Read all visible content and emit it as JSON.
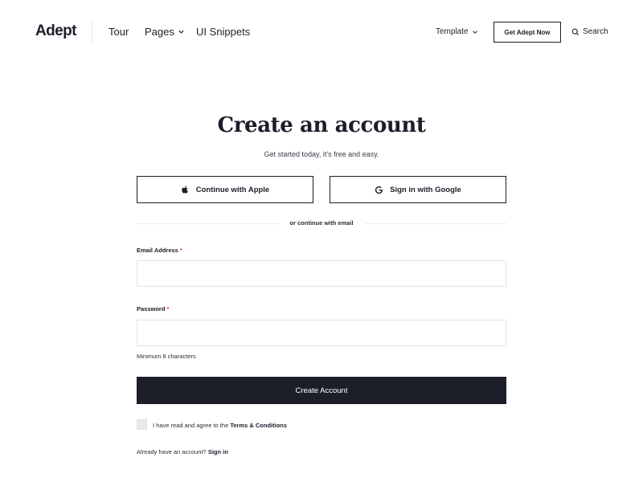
{
  "header": {
    "logo": "Adept",
    "nav": [
      {
        "label": "Tour",
        "has_dropdown": false
      },
      {
        "label": "Pages",
        "has_dropdown": true
      },
      {
        "label": "UI Snippets",
        "has_dropdown": false
      }
    ],
    "template_label": "Template",
    "cta_label": "Get Adept Now",
    "search_label": "Search"
  },
  "main": {
    "title": "Create an account",
    "subtitle": "Get started today, it's free and easy.",
    "apple_button": "Continue with Apple",
    "google_button": "Sign in with Google",
    "divider_text": "or continue with email",
    "email_label": "Email Address",
    "email_value": "",
    "password_label": "Password",
    "password_value": "",
    "required_marker": "*",
    "password_hint": "Minimum 8 characters",
    "create_button": "Create Account",
    "terms_prefix": "I have read and agree to the",
    "terms_link": "Terms & Conditions",
    "terms_checked": false,
    "signin_prefix": "Already have an account?",
    "signin_link": "Sign in"
  },
  "colors": {
    "primary": "#1c1e29",
    "required": "#e0424a",
    "border": "#e4e4e9",
    "background": "#ffffff"
  },
  "icons": [
    "chevron-down-icon",
    "search-icon",
    "apple-icon",
    "google-icon"
  ]
}
